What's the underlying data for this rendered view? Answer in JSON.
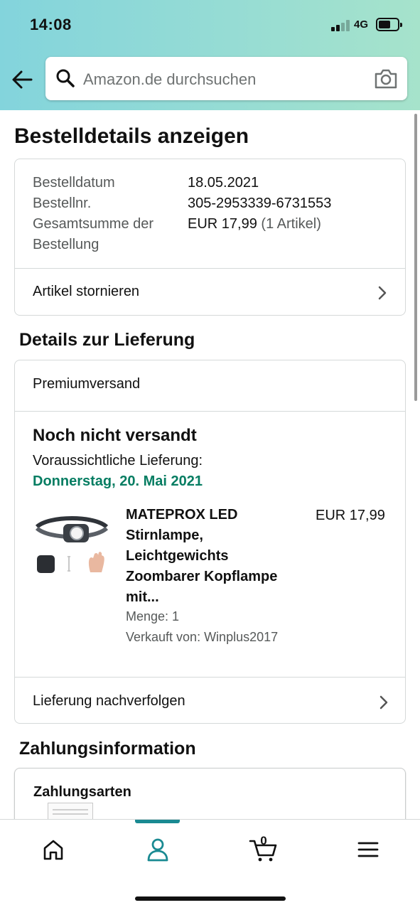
{
  "status_bar": {
    "time": "14:08",
    "network": "4G"
  },
  "search": {
    "placeholder": "Amazon.de durchsuchen"
  },
  "page_title": "Bestelldetails anzeigen",
  "order_summary": {
    "rows": [
      {
        "label": "Bestelldatum",
        "value": "18.05.2021"
      },
      {
        "label": "Bestellnr.",
        "value": "305-2953339-6731553"
      },
      {
        "label_line1": "Gesamtsumme der",
        "label_line2": "Bestellung",
        "value": "EUR 17,99",
        "value_note": "(1 Artikel)"
      }
    ],
    "cancel_link": "Artikel stornieren"
  },
  "delivery": {
    "heading": "Details zur Lieferung",
    "shipping_method": "Premiumversand",
    "status": "Noch nicht versandt",
    "eta_label": "Voraussichtliche Lieferung:",
    "eta_date": "Donnerstag, 20. Mai 2021",
    "eta_color": "#067d62",
    "item": {
      "title_lines": [
        "MATEPROX LED",
        "Stirnlampe,",
        "Leichtgewichts",
        "Zoombarer Kopflampe",
        "mit..."
      ],
      "price": "EUR 17,99",
      "quantity": "Menge: 1",
      "seller": "Verkauft von: Winplus2017"
    },
    "track_link": "Lieferung nachverfolgen"
  },
  "payment": {
    "heading": "Zahlungsinformation",
    "methods_label": "Zahlungsarten"
  },
  "tabbar": {
    "items": [
      "home-icon",
      "account-icon",
      "cart-icon",
      "menu-icon"
    ],
    "active": "account-icon",
    "accent": "#1a8a92",
    "cart_count": "0"
  }
}
